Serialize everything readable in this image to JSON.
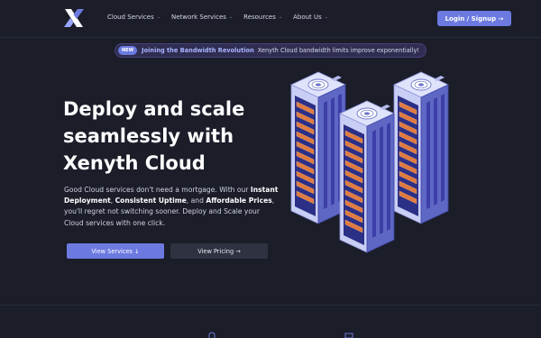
{
  "nav": {
    "logo": "xenyth-logo-icon",
    "links": [
      {
        "label": "Cloud Services"
      },
      {
        "label": "Network Services"
      },
      {
        "label": "Resources"
      },
      {
        "label": "About Us"
      }
    ],
    "login_label": "Login / Signup →"
  },
  "announcement": {
    "badge": "NEW",
    "title": "Joining the Bandwidth Revolution",
    "text": "Xenyth Cloud bandwidth limits improve exponentially!"
  },
  "hero": {
    "title": "Deploy and scale seamlessly with Xenyth Cloud",
    "desc_1": "Good Cloud services don't need a mortgage. With our ",
    "bold_1": "Instant Deployment",
    "desc_2": ", ",
    "bold_2": "Consistent Uptime",
    "desc_3": ", and ",
    "bold_3": "Affordable Prices",
    "desc_4": ", you'll regret not switching sooner. Deploy and Scale your Cloud services with one click.",
    "primary_button": "View Services ↓",
    "secondary_button": "View Pricing →"
  },
  "colors": {
    "background": "#1b1d29",
    "accent": "#6c7ae0",
    "badge_bg": "#2f2d52"
  }
}
